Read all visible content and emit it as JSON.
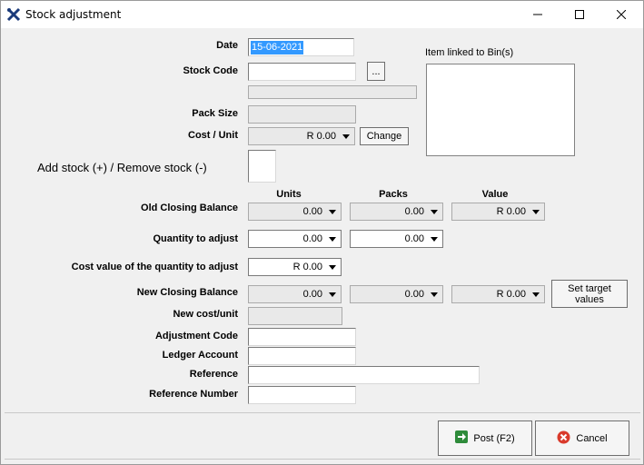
{
  "window": {
    "title": "Stock adjustment"
  },
  "labels": {
    "date": "Date",
    "stock_code": "Stock Code",
    "pack_size": "Pack Size",
    "cost_unit": "Cost / Unit",
    "add_remove": "Add stock (+) / Remove stock (-)",
    "old_closing": "Old Closing Balance",
    "qty_adjust": "Quantity to adjust",
    "cost_value_qty": "Cost value of the quantity to adjust",
    "new_closing": "New Closing Balance",
    "new_cost_unit": "New cost/unit",
    "adjustment_code": "Adjustment Code",
    "ledger_account": "Ledger Account",
    "reference": "Reference",
    "reference_number": "Reference Number",
    "item_linked": "Item linked to Bin(s)"
  },
  "columns": {
    "units": "Units",
    "packs": "Packs",
    "value": "Value"
  },
  "fields": {
    "date": "15-06-2021",
    "stock_code": "",
    "cost_unit": "R 0.00",
    "old_units": "0.00",
    "old_packs": "0.00",
    "old_value": "R 0.00",
    "adj_units": "0.00",
    "adj_packs": "0.00",
    "adj_cost": "R 0.00",
    "new_units": "0.00",
    "new_packs": "0.00",
    "new_value": "R 0.00"
  },
  "buttons": {
    "browse": "...",
    "change": "Change",
    "set_target": "Set target values",
    "post": "Post (F2)",
    "cancel": "Cancel"
  }
}
